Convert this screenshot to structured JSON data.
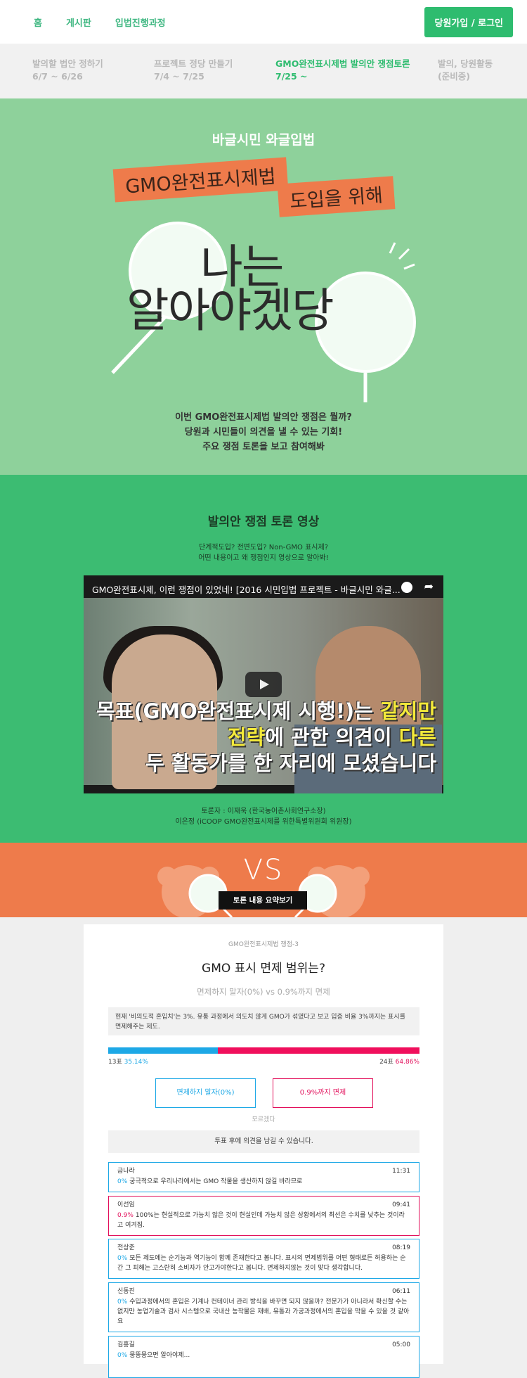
{
  "nav": {
    "links": [
      "홈",
      "게시판",
      "입법진행과정"
    ],
    "login": "당원가입 / 로그인"
  },
  "steps": [
    {
      "title": "발의할 법안 정하기",
      "date": "6/7 ~ 6/26"
    },
    {
      "title": "프로젝트 정당 만들기",
      "date": "7/4 ~ 7/25"
    },
    {
      "title": "GMO완전표시제법 발의안 쟁점토론",
      "date": "7/25 ~"
    },
    {
      "title": "발의, 당원활동",
      "date": "(준비중)"
    }
  ],
  "hero": {
    "kicker": "바글시민 와글입법",
    "tag1": "GMO완전표시제법",
    "tag2": "도입을 위해",
    "big1": "나는",
    "big2": "알아야겠당",
    "desc": [
      "이번 GMO완전표시제법 발의안 쟁점은 뭘까?",
      "당원과 시민들이 의견을 낼 수 있는 기회!",
      "주요 쟁점 토론을 보고 참여해봐"
    ]
  },
  "video_section": {
    "title": "발의안 쟁점 토론 영상",
    "sub": [
      "단계적도입? 전면도입? Non-GMO 표시제?",
      "어떤 내용이고 왜 쟁점인지 영상으로 알아봐!"
    ],
    "video_title": "GMO완전표시제, 이런 쟁점이 있었네! [2016 시민입법 프로젝트 - 바글시민 와글...",
    "caption1a": "목표(GMO완전표시제 시행!)는 ",
    "caption1b": "같지만",
    "caption2a": "전략",
    "caption2b": "에 관한 의견이 ",
    "caption2c": "다른",
    "caption3": "두 활동가를 한 자리에 모셨습니다",
    "credits": [
      "토론자 : 이재욱 (한국농어촌사회연구소장)",
      "이은정 (iCOOP GMO완전표시제를 위한특별위원회 위원장)"
    ]
  },
  "vs": {
    "text": "VS",
    "summary_button": "토론 내용 요약보기"
  },
  "card": {
    "label": "GMO완전표시제법 쟁점-3",
    "title": "GMO 표시 면제 범위는?",
    "versus": "면제하지 말자(0%) vs 0.9%까지 면제",
    "note": "현재 '비의도적 혼입치'는 3%. 유통 과정에서 의도치 않게 GMO가 섞였다고 보고 입증 비율 3%까지는 표시를 면제해주는 제도.",
    "left_votes": "13표",
    "left_pct": "35.14%",
    "right_votes": "24표",
    "right_pct": "64.86%",
    "left_ratio": 0.3514,
    "btn_a": "면제하지 말자(0%)",
    "btn_b": "0.9%까지 면제",
    "unsure": "모르겠다",
    "after": "투표 후에 의견을 남길 수 있습니다."
  },
  "comments": [
    {
      "name": "금나라",
      "time": "11:31",
      "pct": "0%",
      "side": "a",
      "text": "궁극적으로 우리나라에서는 GMO 작물을 생산하지 않길 바라므로"
    },
    {
      "name": "이선임",
      "time": "09:41",
      "pct": "0.9%",
      "side": "b",
      "text": "100%는 현실적으로 가능치 않은 것이 현실인데 가능치 않은 상황에서의 최선은 수치를 낮추는 것이라고 여겨짐."
    },
    {
      "name": "전상준",
      "time": "08:19",
      "pct": "0%",
      "side": "a",
      "text": "모든 제도에는 순기능과 역기능이 함께 존재한다고 봅니다. 표시의 면제범위를 어떤 형태로든 허용하는 순간 그 피해는 고스란히 소비자가 안고가야한다고 봅니다. 면제하지않는 것이 맞다 생각합니다."
    },
    {
      "name": "신동진",
      "time": "06:11",
      "pct": "0%",
      "side": "a",
      "text": "수입과정에서의 혼입은 기계나 컨테이너 관리 방식을 바꾸면 되지 않을까? 전문가가 아니라서 확신할 수는 없지만 농업기술과 검사 시스템으로 국내산 농작물은 재배, 유통과 가공과정에서의 혼입을 막을 수 있을 것 같아요"
    },
    {
      "name": "김홍길",
      "time": "05:00",
      "pct": "0%",
      "side": "a",
      "text": "뭉뚱뭉으면 알아야제..."
    }
  ],
  "colors": {
    "green_nav": "#41b883",
    "hero_bg": "#8ed19b",
    "video_bg": "#3cbc72",
    "vs_bg": "#ee7b4b",
    "blue": "#1da8e6",
    "pink": "#e20e5a"
  }
}
